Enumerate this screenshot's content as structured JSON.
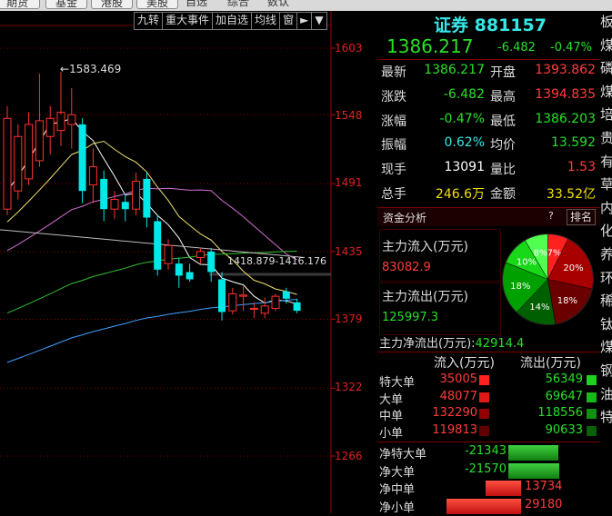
{
  "top_tabs": [
    {
      "label": "期货"
    },
    {
      "label": "基金"
    },
    {
      "label": "港股"
    },
    {
      "label": "美股"
    }
  ],
  "top_labels": [
    "自选",
    "综合",
    "数认"
  ],
  "chart": {
    "toolbar": [
      "九转",
      "重大事件",
      "加自选",
      "均线",
      "窗"
    ],
    "toolbar_arrow": "►",
    "toolbar_dropdown": "▼",
    "price_axis": [
      "1603",
      "1548",
      "1491",
      "1435",
      "1379",
      "1322",
      "1266"
    ],
    "high_marker": "1583.469",
    "range_label": "1418.879-1416.176",
    "colors": {
      "up": "#ff3232",
      "down": "#00e8e8",
      "ma5": "#ffffff",
      "ma10": "#f0e070",
      "ma20": "#d070d0",
      "ma60": "#30c030",
      "ma120": "#40a0ff"
    }
  },
  "chart_data": {
    "type": "candlestick",
    "price_range": [
      1240,
      1630
    ],
    "price_ticks": [
      1603,
      1548,
      1491,
      1435,
      1379,
      1322,
      1266
    ],
    "annotations": [
      "1583.469",
      "1418.879-1416.176"
    ],
    "candles": [
      {
        "o": 1470,
        "h": 1555,
        "l": 1465,
        "c": 1545
      },
      {
        "o": 1485,
        "h": 1540,
        "l": 1478,
        "c": 1530
      },
      {
        "o": 1495,
        "h": 1550,
        "l": 1490,
        "c": 1540
      },
      {
        "o": 1510,
        "h": 1582,
        "l": 1505,
        "c": 1543
      },
      {
        "o": 1530,
        "h": 1555,
        "l": 1515,
        "c": 1545
      },
      {
        "o": 1535,
        "h": 1583,
        "l": 1522,
        "c": 1550
      },
      {
        "o": 1540,
        "h": 1570,
        "l": 1520,
        "c": 1548
      },
      {
        "o": 1540,
        "h": 1545,
        "l": 1475,
        "c": 1485
      },
      {
        "o": 1490,
        "h": 1520,
        "l": 1475,
        "c": 1505
      },
      {
        "o": 1495,
        "h": 1502,
        "l": 1460,
        "c": 1470
      },
      {
        "o": 1470,
        "h": 1485,
        "l": 1462,
        "c": 1478
      },
      {
        "o": 1476,
        "h": 1483,
        "l": 1460,
        "c": 1470
      },
      {
        "o": 1470,
        "h": 1500,
        "l": 1465,
        "c": 1493
      },
      {
        "o": 1495,
        "h": 1500,
        "l": 1455,
        "c": 1463
      },
      {
        "o": 1460,
        "h": 1465,
        "l": 1415,
        "c": 1420
      },
      {
        "o": 1425,
        "h": 1445,
        "l": 1420,
        "c": 1440
      },
      {
        "o": 1425,
        "h": 1430,
        "l": 1405,
        "c": 1415
      },
      {
        "o": 1418,
        "h": 1425,
        "l": 1410,
        "c": 1412
      },
      {
        "o": 1430,
        "h": 1438,
        "l": 1425,
        "c": 1435
      },
      {
        "o": 1435,
        "h": 1438,
        "l": 1410,
        "c": 1418
      },
      {
        "o": 1412,
        "h": 1418,
        "l": 1378,
        "c": 1385
      },
      {
        "o": 1386,
        "h": 1405,
        "l": 1383,
        "c": 1400
      },
      {
        "o": 1398,
        "h": 1406,
        "l": 1386,
        "c": 1399
      },
      {
        "o": 1388,
        "h": 1393,
        "l": 1380,
        "c": 1388
      },
      {
        "o": 1384,
        "h": 1397,
        "l": 1380,
        "c": 1390
      },
      {
        "o": 1388,
        "h": 1400,
        "l": 1386,
        "c": 1398
      },
      {
        "o": 1402,
        "h": 1405,
        "l": 1392,
        "c": 1396
      },
      {
        "o": 1393,
        "h": 1396,
        "l": 1384,
        "c": 1386
      }
    ]
  },
  "quote": {
    "name": "证券",
    "code": "881157",
    "price": "1386.217",
    "change": "-6.482",
    "change_pct": "-0.47%",
    "rows": [
      {
        "l1": "最新",
        "v1": "1386.217",
        "c1": "green",
        "l2": "开盘",
        "v2": "1393.862",
        "c2": "red"
      },
      {
        "l1": "涨跌",
        "v1": "-6.482",
        "c1": "green",
        "l2": "最高",
        "v2": "1394.835",
        "c2": "red"
      },
      {
        "l1": "涨幅",
        "v1": "-0.47%",
        "c1": "green",
        "l2": "最低",
        "v2": "1386.203",
        "c2": "green"
      },
      {
        "l1": "振幅",
        "v1": "0.62%",
        "c1": "cyan",
        "l2": "均价",
        "v2": "13.592",
        "c2": "green"
      },
      {
        "l1": "现手",
        "v1": "13091",
        "c1": "white",
        "l2": "量比",
        "v2": "1.53",
        "c2": "red"
      },
      {
        "l1": "总手",
        "v1": "246.6万",
        "c1": "yellow",
        "l2": "金额",
        "v2": "33.52亿",
        "c2": "yellow"
      }
    ]
  },
  "capital": {
    "title": "资金分析",
    "help": "?",
    "rank": "排名",
    "inflow_label": "主力流入(万元)",
    "inflow_value": "83082.9",
    "outflow_label": "主力流出(万元)",
    "outflow_value": "125997.3",
    "net_label": "主力净流出(万元):",
    "net_value": "42914.4",
    "pie": [
      {
        "pct": 7,
        "label": "7%",
        "color": "#ff2020"
      },
      {
        "pct": 20,
        "label": "20%",
        "color": "#a80000"
      },
      {
        "pct": 18,
        "label": "18%",
        "color": "#6a0000"
      },
      {
        "pct": 14,
        "label": "14%",
        "color": "#006000"
      },
      {
        "pct": 18,
        "label": "18%",
        "color": "#00a000"
      },
      {
        "pct": 10,
        "label": "10%",
        "color": "#18d818"
      },
      {
        "pct": 8,
        "label": "8%",
        "color": "#50ff50"
      }
    ]
  },
  "flow_table": {
    "header_in": "流入(万元)",
    "header_out": "流出(万元)",
    "rows": [
      {
        "label": "特大单",
        "in": "35005",
        "out": "56349",
        "in_shade": "#ff2020",
        "out_shade": "#20d020"
      },
      {
        "label": "大单",
        "in": "48077",
        "out": "69647",
        "in_shade": "#e01818",
        "out_shade": "#18b818"
      },
      {
        "label": "中单",
        "in": "132290",
        "out": "118556",
        "in_shade": "#900000",
        "out_shade": "#109010"
      },
      {
        "label": "小单",
        "in": "119813",
        "out": "90633",
        "in_shade": "#600000",
        "out_shade": "#0a600a"
      }
    ]
  },
  "net_table": [
    {
      "label": "净特大单",
      "value": "-21343",
      "dir": "out",
      "frac": 0.73
    },
    {
      "label": "净大单",
      "value": "-21570",
      "dir": "out",
      "frac": 0.74
    },
    {
      "label": "净中单",
      "value": "13734",
      "dir": "in",
      "frac": 0.47
    },
    {
      "label": "净小单",
      "value": "29180",
      "dir": "in",
      "frac": 1.0
    }
  ],
  "edge_list": [
    "板",
    "煤",
    "磷",
    "煤",
    "培",
    "贵",
    "有",
    "草",
    "内",
    "化",
    "养",
    "环",
    "稀",
    "钛",
    "煤",
    "钢",
    "油",
    "特"
  ]
}
